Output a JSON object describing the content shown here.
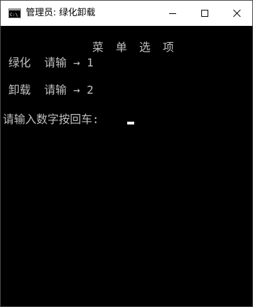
{
  "window": {
    "title": "管理员:  绿化卸载",
    "icon": "console-icon"
  },
  "controls": {
    "minimize": "minimize-icon",
    "maximize": "maximize-icon",
    "close": "close-icon"
  },
  "console": {
    "lines": {
      "heading": "菜 单 选 项",
      "option1": "绿化  请输 → 1",
      "option2": "卸载  请输 → 2",
      "prompt": "请输入数字按回车:"
    },
    "colors": {
      "background": "#000000",
      "text": "#c0c0c0",
      "cursor": "#ffffff"
    }
  }
}
